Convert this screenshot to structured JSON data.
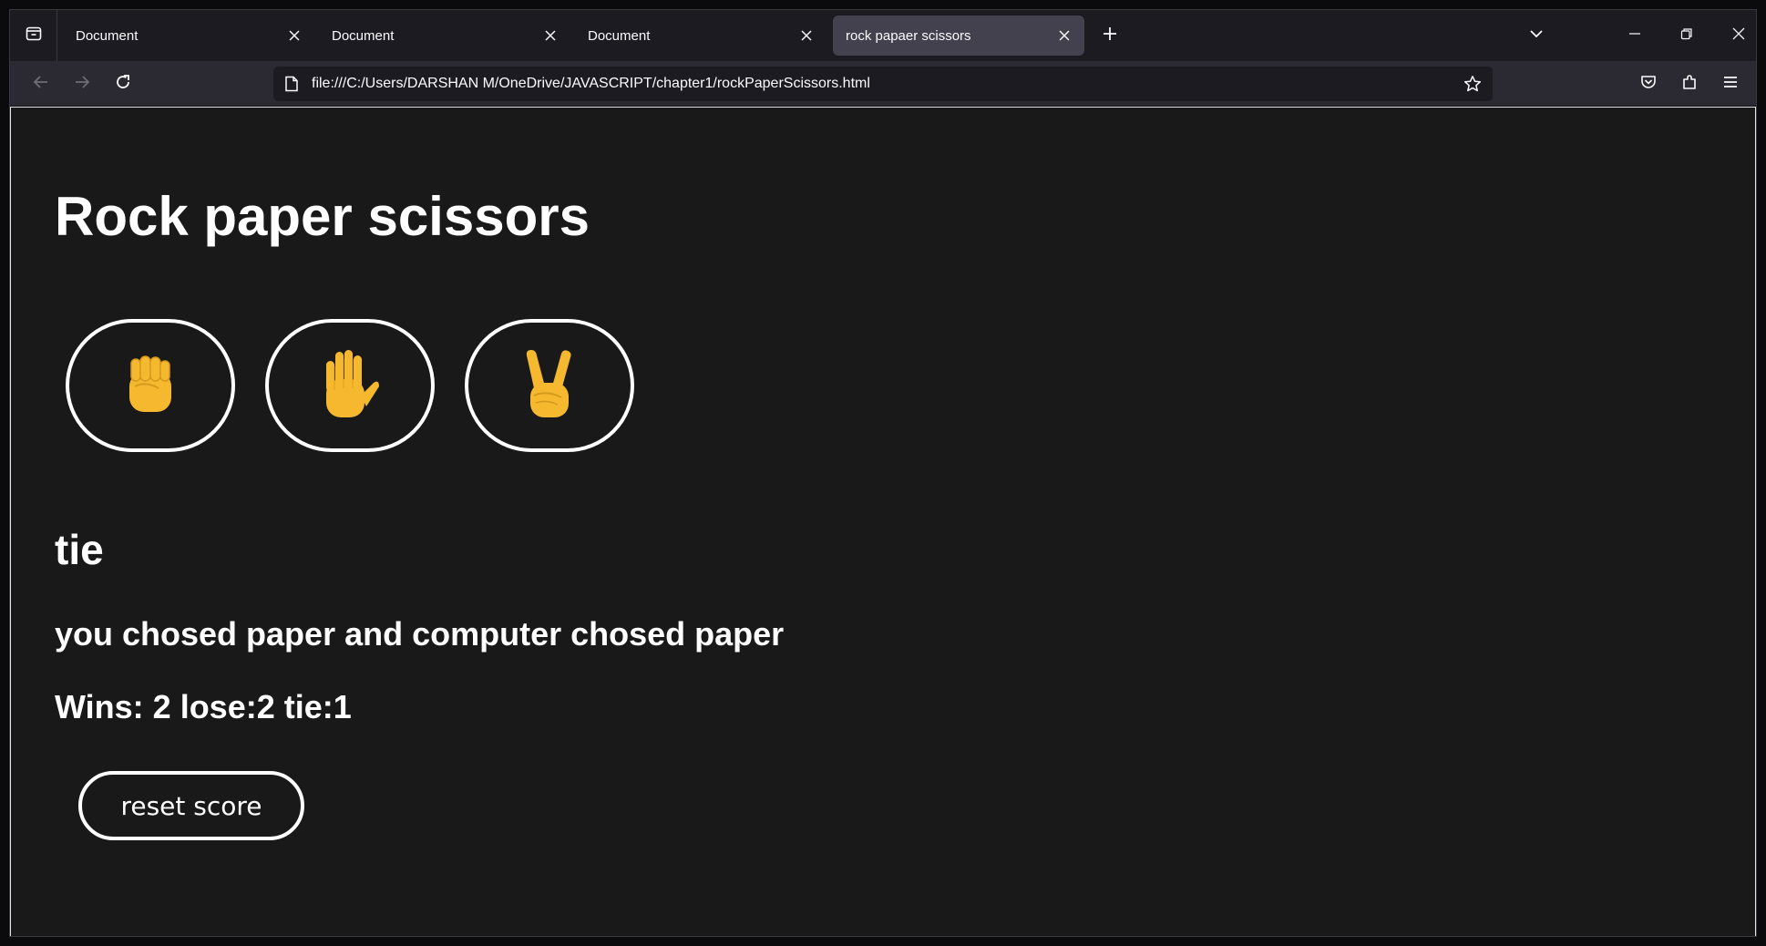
{
  "browser": {
    "tabs": [
      {
        "title": "Document",
        "active": false
      },
      {
        "title": "Document",
        "active": false
      },
      {
        "title": "Document",
        "active": false
      },
      {
        "title": "rock papaer scissors",
        "active": true
      }
    ],
    "url": "file:///C:/Users/DARSHAN M/OneDrive/JAVASCRIPT/chapter1/rockPaperScissors.html",
    "icons": [
      "tab-list-icon",
      "close-icon",
      "new-tab-icon",
      "chevron-down-icon",
      "minimize-icon",
      "restore-icon",
      "window-close-icon",
      "back-arrow-icon",
      "forward-arrow-icon",
      "reload-icon",
      "page-icon",
      "bookmark-star-icon",
      "pocket-icon",
      "extensions-icon",
      "menu-icon"
    ]
  },
  "page": {
    "title": "Rock paper scissors",
    "moves": [
      {
        "name": "rock",
        "emoji": "✊"
      },
      {
        "name": "paper",
        "emoji": "🖐"
      },
      {
        "name": "scissors",
        "emoji": "✌"
      }
    ],
    "result": "tie",
    "moves_text": "you chosed paper and computer chosed paper",
    "score_text": "Wins: 2 lose:2 tie:1",
    "reset_label": "reset score"
  },
  "colors": {
    "page_background": "#19191a",
    "text": "#ffffff",
    "emoji": "#f5b82e",
    "browser_chrome": "#1c1b22",
    "active_tab": "#42414d"
  }
}
